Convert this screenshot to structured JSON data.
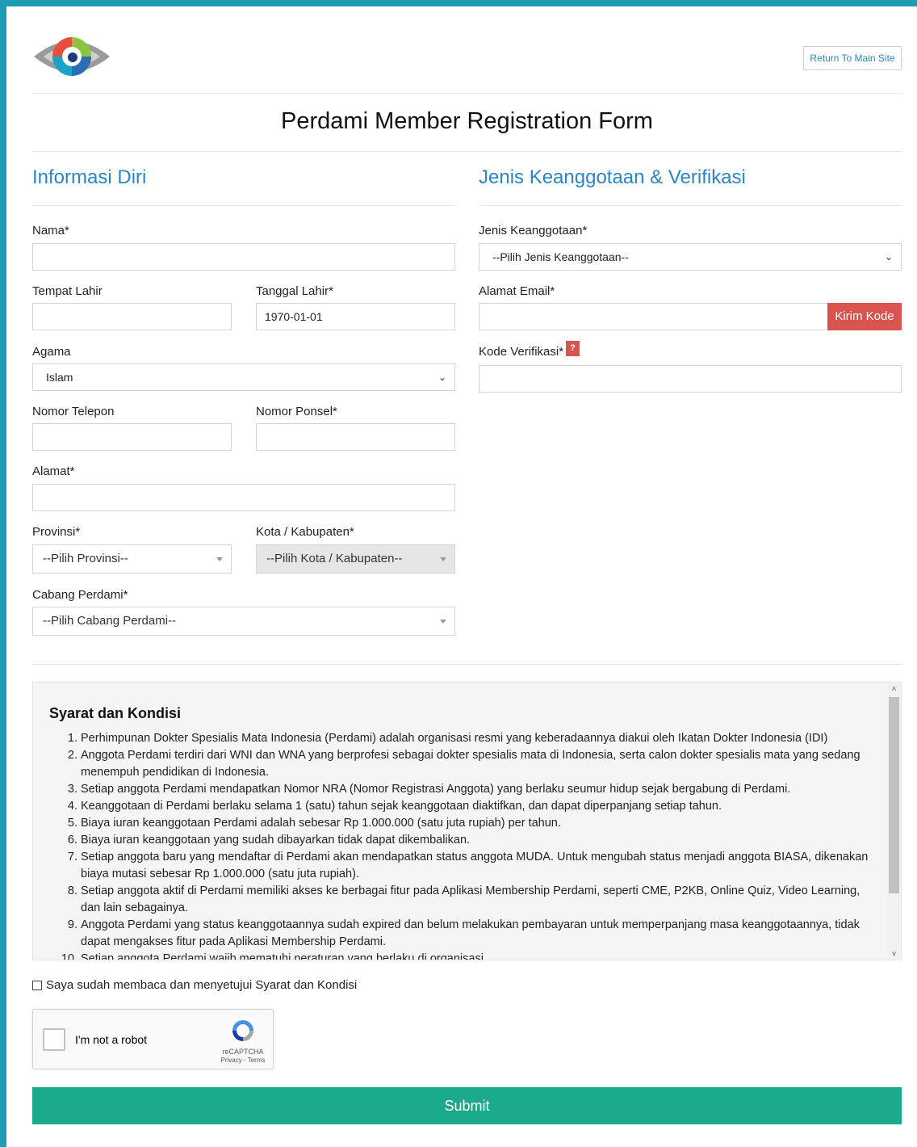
{
  "header": {
    "return_label": "Return To Main Site",
    "title": "Perdami Member Registration Form"
  },
  "left": {
    "section_title": "Informasi Diri",
    "nama_label": "Nama*",
    "nama_value": "",
    "tempat_lahir_label": "Tempat Lahir",
    "tempat_lahir_value": "",
    "tanggal_lahir_label": "Tanggal Lahir*",
    "tanggal_lahir_value": "1970-01-01",
    "agama_label": "Agama",
    "agama_value": "Islam",
    "telepon_label": "Nomor Telepon",
    "ponsel_label": "Nomor Ponsel*",
    "alamat_label": "Alamat*",
    "provinsi_label": "Provinsi*",
    "provinsi_value": "--Pilih Provinsi--",
    "kota_label": "Kota / Kabupaten*",
    "kota_value": "--Pilih Kota / Kabupaten--",
    "cabang_label": "Cabang Perdami*",
    "cabang_value": "--Pilih Cabang Perdami--"
  },
  "right": {
    "section_title": "Jenis Keanggotaan & Verifikasi",
    "jenis_label": "Jenis Keanggotaan*",
    "jenis_value": "--Pilih Jenis Keanggotaan--",
    "email_label": "Alamat Email*",
    "kirim_label": "Kirim Kode",
    "kode_label": "Kode Verifikasi*",
    "help_mark": "?"
  },
  "terms": {
    "title": "Syarat dan Kondisi",
    "items": [
      "Perhimpunan Dokter Spesialis Mata Indonesia (Perdami) adalah organisasi resmi yang keberadaannya diakui oleh Ikatan Dokter Indonesia (IDI)",
      "Anggota Perdami terdiri dari WNI dan WNA yang berprofesi sebagai dokter spesialis mata di Indonesia, serta calon dokter spesialis mata yang sedang menempuh pendidikan di Indonesia.",
      "Setiap anggota Perdami mendapatkan Nomor NRA (Nomor Registrasi Anggota) yang berlaku seumur hidup sejak bergabung di Perdami.",
      "Keanggotaan di Perdami berlaku selama 1 (satu) tahun sejak keanggotaan diaktifkan, dan dapat diperpanjang setiap tahun.",
      "Biaya iuran keanggotaan Perdami adalah sebesar Rp 1.000.000 (satu juta rupiah) per tahun.",
      "Biaya iuran keanggotaan yang sudah dibayarkan tidak dapat dikembalikan.",
      "Setiap anggota baru yang mendaftar di Perdami akan mendapatkan status anggota MUDA. Untuk mengubah status menjadi anggota BIASA, dikenakan biaya mutasi sebesar Rp 1.000.000 (satu juta rupiah).",
      "Setiap anggota aktif di Perdami memiliki akses ke berbagai fitur pada Aplikasi Membership Perdami, seperti CME, P2KB, Online Quiz, Video Learning, dan lain sebagainya.",
      "Anggota Perdami yang status keanggotaannya sudah expired dan belum melakukan pembayaran untuk memperpanjang masa keanggotaannya, tidak dapat mengakses fitur pada Aplikasi Membership Perdami.",
      "Setiap anggota Perdami wajib mematuhi peraturan yang berlaku di organisasi"
    ]
  },
  "agree_label": "Saya sudah membaca dan menyetujui Syarat dan Kondisi",
  "recaptcha": {
    "label": "I'm not a robot",
    "brand": "reCAPTCHA",
    "links": "Privacy - Terms"
  },
  "submit_label": "Submit",
  "colors": {
    "frame": "#1e9bb5",
    "section_title": "#2a86c2",
    "danger": "#d9534f",
    "submit": "#1aaa8a"
  }
}
